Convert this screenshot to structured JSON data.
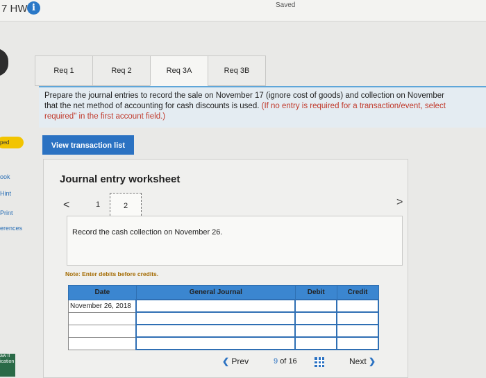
{
  "header": {
    "title": "7 HW",
    "info_icon": "i",
    "status": "Saved"
  },
  "sidebar": {
    "items": [
      {
        "label": "ped"
      },
      {
        "label": "ook"
      },
      {
        "label": "Hint"
      },
      {
        "label": "Print"
      },
      {
        "label": "erences"
      }
    ],
    "bottom_label": "aw ll ication"
  },
  "tabs": [
    {
      "label": "Req 1"
    },
    {
      "label": "Req 2"
    },
    {
      "label": "Req 3A"
    },
    {
      "label": "Req 3B"
    }
  ],
  "instruction": {
    "line1": "Prepare the journal entries to record the sale on November 17 (ignore cost of goods) and collection on November",
    "line2_plain": "that the net method of accounting for cash discounts is used.",
    "line2_red": " (If no entry is required for a transaction/event, select",
    "line3_red": "required\" in the first account field.)"
  },
  "view_transaction_button": "View transaction list",
  "worksheet": {
    "title": "Journal entry worksheet",
    "prev_arrow": "<",
    "next_arrow": ">",
    "pages": [
      "1",
      "2"
    ],
    "record_text": "Record the cash collection on November 26.",
    "note": "Note: Enter debits before credits.",
    "columns": [
      "Date",
      "General Journal",
      "Debit",
      "Credit"
    ],
    "rows": [
      [
        "November 26, 2018",
        "",
        "",
        ""
      ],
      [
        "",
        "",
        "",
        ""
      ],
      [
        "",
        "",
        "",
        ""
      ],
      [
        "",
        "",
        "",
        ""
      ]
    ]
  },
  "pager": {
    "prev_label": "Prev",
    "current": "9",
    "of": "of",
    "total": "16",
    "next_label": "Next"
  },
  "colors": {
    "accent": "#2b72c2",
    "table_header": "#3b86d0",
    "instruction_bg": "#e4ecf2",
    "warning_text": "#c0392b"
  }
}
